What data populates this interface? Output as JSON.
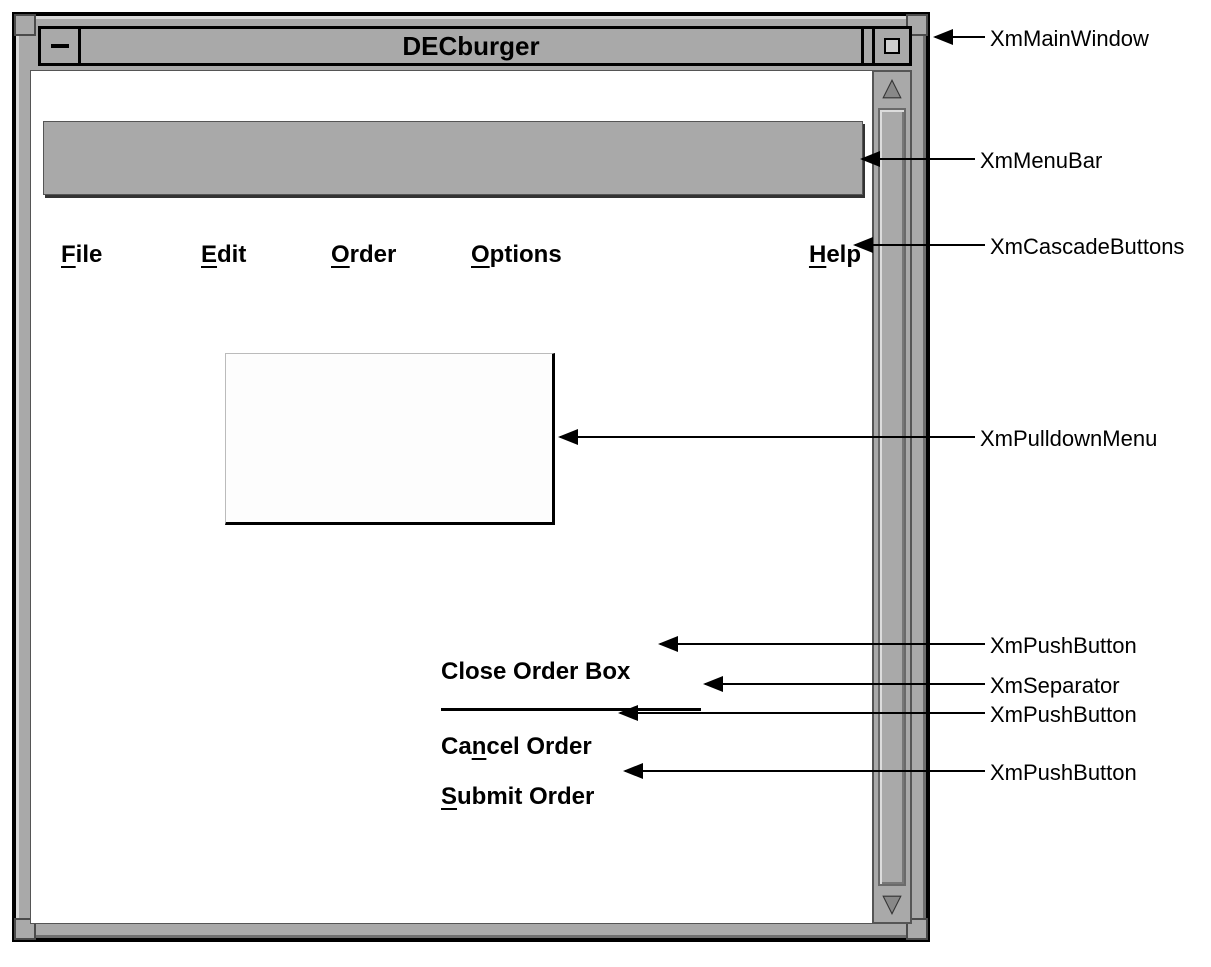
{
  "window": {
    "title": "DECburger"
  },
  "menubar": {
    "items": [
      {
        "label": "File",
        "mnemonic": "F"
      },
      {
        "label": "Edit",
        "mnemonic": "E"
      },
      {
        "label": "Order",
        "mnemonic": "O"
      },
      {
        "label": "Options",
        "mnemonic": "O"
      },
      {
        "label": "Help",
        "mnemonic": "H"
      }
    ]
  },
  "pulldown": {
    "items": [
      {
        "type": "push",
        "label": "Close Order Box",
        "mnemonic_index": null
      },
      {
        "type": "separator"
      },
      {
        "type": "push",
        "label": "Cancel Order",
        "mnemonic": "n"
      },
      {
        "type": "push",
        "label": "Submit Order",
        "mnemonic": "S"
      }
    ]
  },
  "annotations": {
    "main_window": "XmMainWindow",
    "menu_bar": "XmMenuBar",
    "cascade_buttons": "XmCascadeButtons",
    "pulldown_menu": "XmPulldownMenu",
    "push_button_1": "XmPushButton",
    "separator": "XmSeparator",
    "push_button_2": "XmPushButton",
    "push_button_3": "XmPushButton"
  }
}
